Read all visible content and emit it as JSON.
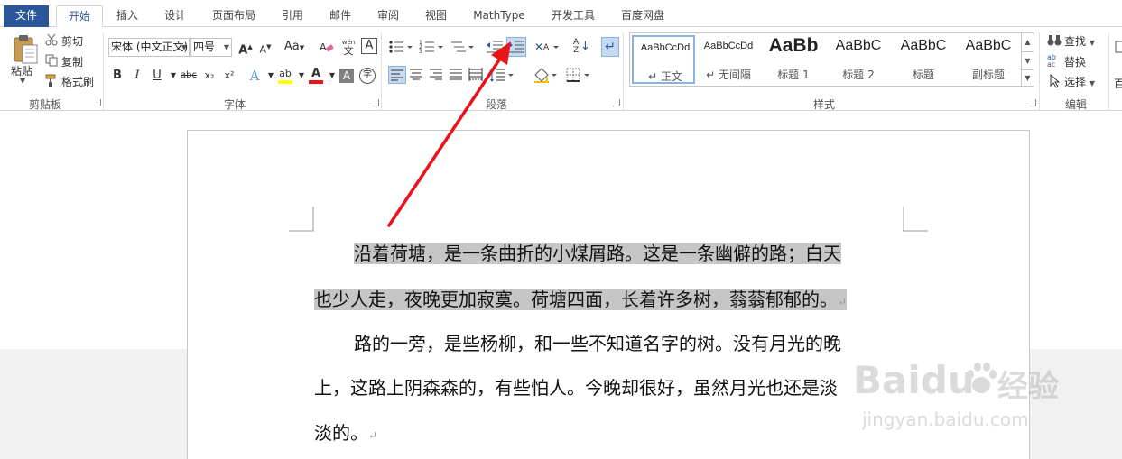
{
  "tabs": [
    "文件",
    "开始",
    "插入",
    "设计",
    "页面布局",
    "引用",
    "邮件",
    "审阅",
    "视图",
    "MathType",
    "开发工具",
    "百度网盘"
  ],
  "clipboard": {
    "paste": "粘贴",
    "cut": "剪切",
    "copy": "复制",
    "format_painter": "格式刷",
    "group": "剪贴板"
  },
  "font": {
    "name": "宋体 (中文正文)",
    "size": "四号",
    "group": "字体",
    "grow": "A",
    "shrink": "A",
    "change_case": "Aa",
    "phonetic_top": "wén",
    "phonetic_char": "文",
    "enclose": "A",
    "bold": "B",
    "italic": "I",
    "underline": "U",
    "strike": "abc",
    "subscript": "x₂",
    "superscript": "x²",
    "effects": "A",
    "highlight": "ab",
    "font_color": "A",
    "shading": "A",
    "circle": "字"
  },
  "paragraph": {
    "group": "段落",
    "sort": "A↓Z"
  },
  "styles": {
    "group": "样式",
    "items": [
      {
        "sample": "AaBbCcDd",
        "name": "↵ 正文"
      },
      {
        "sample": "AaBbCcDd",
        "name": "↵ 无间隔"
      },
      {
        "sample": "AaBb",
        "name": "标题 1"
      },
      {
        "sample": "AaBbC",
        "name": "标题 2"
      },
      {
        "sample": "AaBbC",
        "name": "标题"
      },
      {
        "sample": "AaBbC",
        "name": "副标题"
      }
    ]
  },
  "editing": {
    "find": "查找",
    "replace": "替换",
    "select": "选择",
    "group": "编辑",
    "extra": "百"
  },
  "document": {
    "p1_line1": "沿着荷塘，是一条曲折的小煤屑路。这是一条幽僻的路；白天",
    "p1_line2": "也少人走，夜晚更加寂寞。荷塘四面，长着许多树，蓊蓊郁郁的。",
    "p2_line1": "路的一旁，是些杨柳，和一些不知道名字的树。没有月光的晚",
    "p2_line2": "上，这路上阴森森的，有些怕人。今晚却很好，虽然月光也还是淡",
    "p2_line3": "淡的。",
    "para_mark": "↵"
  },
  "watermark": {
    "brand_latin": "Baidu",
    "brand_cn": "经验",
    "url": "jingyan.baidu.com"
  },
  "colors": {
    "file_tab": "#2b579a",
    "arrow": "#e8141a",
    "highlight_bar": "#ffff00",
    "font_color_bar": "#e8141a"
  }
}
